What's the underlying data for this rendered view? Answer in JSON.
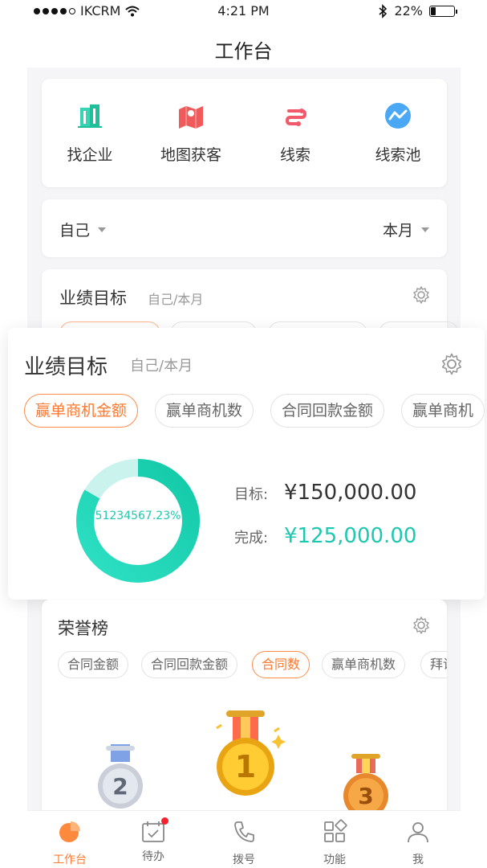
{
  "status_bar": {
    "carrier": "IKCRM",
    "time": "4:21 PM",
    "battery": "22%",
    "battery_level": 0.22
  },
  "nav": {
    "title": "工作台"
  },
  "quick_actions": [
    {
      "label": "找企业",
      "icon": "building-icon"
    },
    {
      "label": "地图获客",
      "icon": "map-icon"
    },
    {
      "label": "线索",
      "icon": "lead-icon"
    },
    {
      "label": "线索池",
      "icon": "lead-pool-icon"
    }
  ],
  "filters": {
    "scope": "自己",
    "period": "本月"
  },
  "performance": {
    "title": "业绩目标",
    "subtitle": "自己/本月",
    "tabs": [
      "赢单商机金额",
      "赢单商机数",
      "合同回款金额",
      "赢单商机"
    ],
    "active_tab": 0,
    "donut_label": "51234567.23%",
    "progress": 0.8333,
    "target_label": "目标:",
    "target_value": "¥150,000.00",
    "done_label": "完成:",
    "done_value": "¥125,000.00",
    "colors": {
      "accent": "#1ec8b0",
      "track": "#c9f3ec",
      "active_tab": "#ff7a30"
    }
  },
  "honor": {
    "title": "荣誉榜",
    "tabs": [
      "合同金额",
      "合同回款金额",
      "合同数",
      "赢单商机数",
      "拜访"
    ],
    "active_tab": 2,
    "medals": [
      "2",
      "1",
      "3"
    ]
  },
  "tabbar": {
    "items": [
      {
        "label": "工作台",
        "icon": "dashboard-icon",
        "active": true
      },
      {
        "label": "待办",
        "icon": "calendar-icon",
        "badge": true
      },
      {
        "label": "拨号",
        "icon": "phone-icon"
      },
      {
        "label": "功能",
        "icon": "apps-icon"
      },
      {
        "label": "我",
        "icon": "user-icon"
      }
    ]
  }
}
